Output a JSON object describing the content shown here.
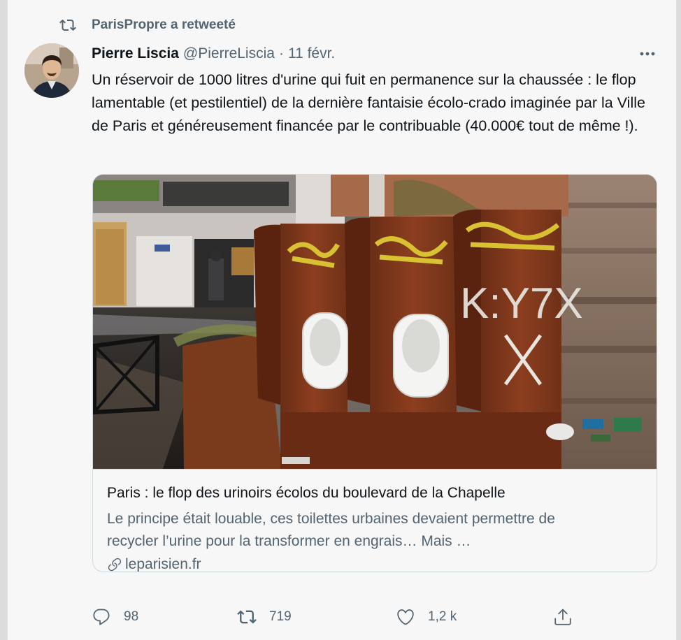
{
  "social_context": {
    "text": "ParisPropre a retweeté",
    "icon": "retweet-icon"
  },
  "author": {
    "name": "Pierre Liscia",
    "handle": "@PierreLiscia",
    "separator": "·",
    "date": "11 févr."
  },
  "tweet": {
    "text": "Un réservoir de 1000 litres d'urine qui fuit en permanence sur la chaussée : le flop lamentable (et pestilentiel) de la dernière fantaisie écolo-crado imaginée par la Ville de Paris et généreusement financée par le contribuable (40.000€ tout de même !)."
  },
  "card": {
    "title": "Paris : le flop des urinoirs écolos du boulevard de la Chapelle",
    "description": "Le principe était louable, ces toilettes urbaines devaient permettre de recycler l’urine pour la transformer en engrais… Mais …",
    "domain": "leparisien.fr",
    "image_graffiti_text": "K:Y7X"
  },
  "actions": {
    "reply": {
      "count": "98",
      "icon": "reply-icon"
    },
    "retweet": {
      "count": "719",
      "icon": "retweet-icon"
    },
    "like": {
      "count": "1,2 k",
      "icon": "heart-icon"
    },
    "share": {
      "icon": "share-icon"
    }
  },
  "colors": {
    "text_primary": "#0f1419",
    "text_secondary": "#536471",
    "border": "#cfd9de",
    "background": "#f7f7f7"
  }
}
